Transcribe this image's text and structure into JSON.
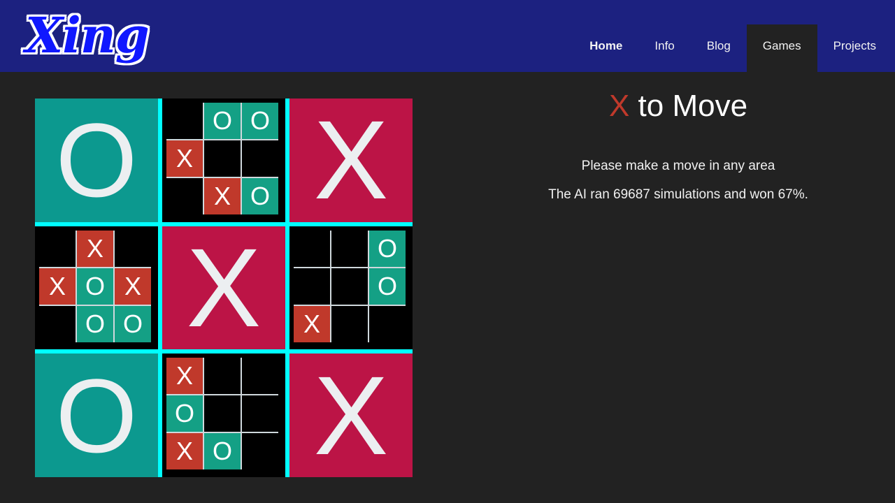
{
  "header": {
    "logo_text": "Xing",
    "nav": [
      {
        "label": "Home",
        "active": false,
        "bold": true
      },
      {
        "label": "Info",
        "active": false,
        "bold": false
      },
      {
        "label": "Blog",
        "active": false,
        "bold": false
      },
      {
        "label": "Games",
        "active": true,
        "bold": false
      },
      {
        "label": "Projects",
        "active": false,
        "bold": false
      }
    ]
  },
  "status": {
    "turn_mark": "X",
    "title_suffix": " to Move",
    "instruction": "Please make a move in any area",
    "ai_stats": "The AI ran 69687 simulations and won 67%."
  },
  "colors": {
    "header_bg": "#1c2180",
    "page_bg": "#222222",
    "logo_fill": "#1018ff",
    "logo_outline": "#ffffff",
    "grid_line": "#00ffff",
    "x_cell": "#c0392b",
    "o_cell": "#14a085",
    "won_x_bg": "#bc1446",
    "won_o_bg": "#0c998f",
    "mark_white": "#eceff1",
    "turn_mark": "#c0392b"
  },
  "game": {
    "marks": {
      "x": "X",
      "o": "O",
      "empty": ""
    },
    "boards": [
      {
        "index": 0,
        "state": "won",
        "winner": "O",
        "cells": []
      },
      {
        "index": 1,
        "state": "active",
        "winner": null,
        "cells": [
          "",
          "O",
          "O",
          "X",
          "",
          "",
          "",
          "X",
          "O"
        ]
      },
      {
        "index": 2,
        "state": "won",
        "winner": "X",
        "cells": []
      },
      {
        "index": 3,
        "state": "active",
        "winner": null,
        "cells": [
          "",
          "X",
          "",
          "X",
          "O",
          "X",
          "",
          "O",
          "O"
        ]
      },
      {
        "index": 4,
        "state": "won",
        "winner": "X",
        "cells": []
      },
      {
        "index": 5,
        "state": "active",
        "winner": null,
        "cells": [
          "",
          "",
          "O",
          "",
          "",
          "O",
          "X",
          "",
          ""
        ]
      },
      {
        "index": 6,
        "state": "won",
        "winner": "O",
        "cells": []
      },
      {
        "index": 7,
        "state": "active",
        "winner": null,
        "cells": [
          "X",
          "",
          "",
          "O",
          "",
          "",
          "X",
          "O",
          ""
        ]
      },
      {
        "index": 8,
        "state": "won",
        "winner": "X",
        "cells": []
      }
    ]
  }
}
